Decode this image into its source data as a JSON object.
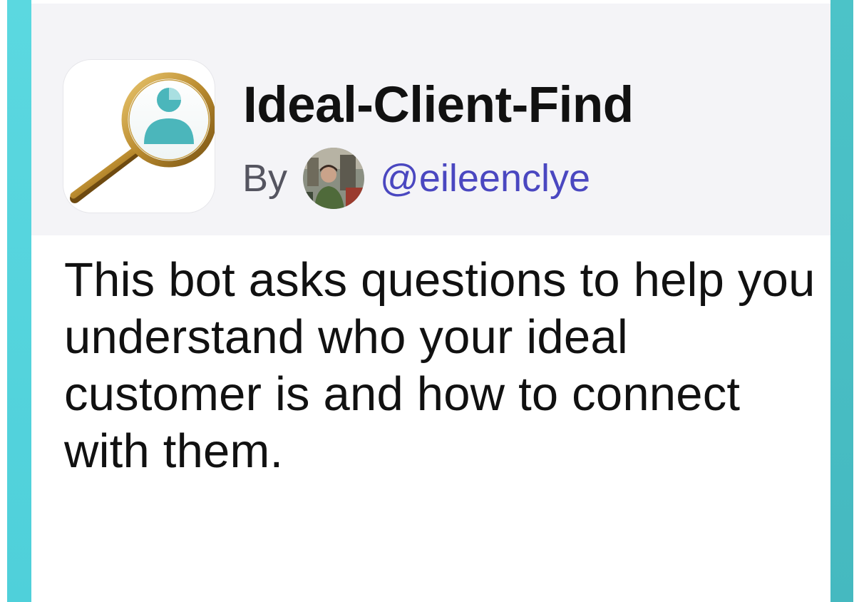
{
  "bot": {
    "name": "Ideal-Client-Find",
    "by_label": "By",
    "author_handle": "@eileenclye",
    "description": "This bot asks questions to help you understand who your ideal customer is and how to connect with them.",
    "icon": "magnifying-glass-person-icon",
    "avatar": "author-avatar"
  },
  "colors": {
    "accent_left": "#5bd8e0",
    "accent_right": "#45b9c0",
    "header_bg": "#f4f4f7",
    "handle": "#4a47c0",
    "title": "#111111",
    "by_label": "#555560"
  }
}
